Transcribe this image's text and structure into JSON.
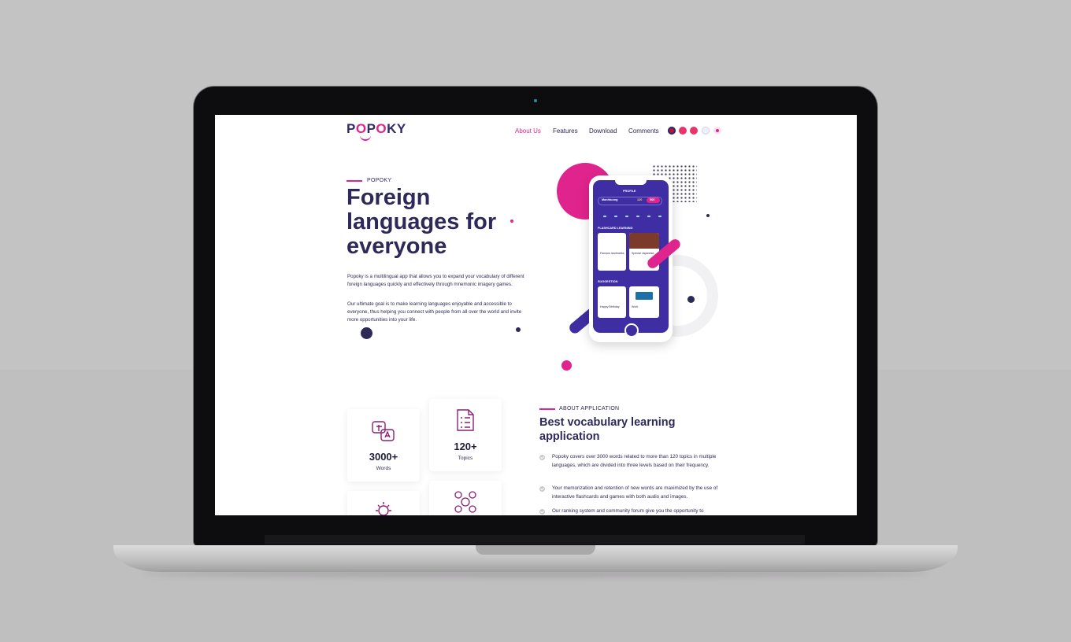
{
  "brand": {
    "name_pre": "P",
    "name_o": "O",
    "name_mid": "P",
    "name_o2": "O",
    "name_post": "KY"
  },
  "nav": {
    "items": [
      "About Us",
      "Features",
      "Download",
      "Comments"
    ],
    "active_index": 0,
    "languages": [
      {
        "name": "english-flag",
        "color": "#c8102e"
      },
      {
        "name": "vietnam-flag",
        "color": "#e8336b"
      },
      {
        "name": "china-flag",
        "color": "#e8336b"
      },
      {
        "name": "korea-flag",
        "color": "#d0d4e6"
      },
      {
        "name": "japan-flag",
        "color": "#f4a7c8"
      }
    ]
  },
  "hero": {
    "eyebrow": "POPOKY",
    "title": "Foreign languages for everyone",
    "para1": "Popoky is a multilingual app that allows you to expand your vocabulary of different foreign languages quickly and effectively through mnemonic imagery games.",
    "para2": "Our ultimate goal is to make learning languages enjoyable and accessible to everyone, thus helping you connect with people from all over the world and invite more opportunities into your life."
  },
  "phone": {
    "profile": "PROFILE",
    "user": "Manhtuong",
    "coins": "120",
    "gems": "560",
    "flashcard": "FLASHCARD LEARNING",
    "card1": "Famous landmarks",
    "card2": "Special Japanese...",
    "suggestion": "SUGGESTION",
    "card3": "Happy Birthday",
    "card4": "Work"
  },
  "stats": [
    {
      "value": "3000+",
      "label": "Words",
      "icon": "translate-icon"
    },
    {
      "value": "120+",
      "label": "Topics",
      "icon": "checklist-icon"
    },
    {
      "value": "",
      "label": "",
      "icon": "lightbulb-icon"
    },
    {
      "value": "",
      "label": "",
      "icon": "community-icon"
    }
  ],
  "about": {
    "eyebrow": "ABOUT APPLICATION",
    "title": "Best vocabulary learning application",
    "bullets": [
      "Popoky covers over 3000 words related to more than 120 topics in multiple languages, which are divided into three levels based on their frequency.",
      "Your memorization and retention of new words are maximized by the use of interactive flashcards and games with both audio and images.",
      "Our ranking system and community forum give you the opportunity to"
    ]
  },
  "colors": {
    "accent": "#e0248d",
    "navy": "#2d2a5a",
    "phone_bg": "#3f2ea3"
  }
}
